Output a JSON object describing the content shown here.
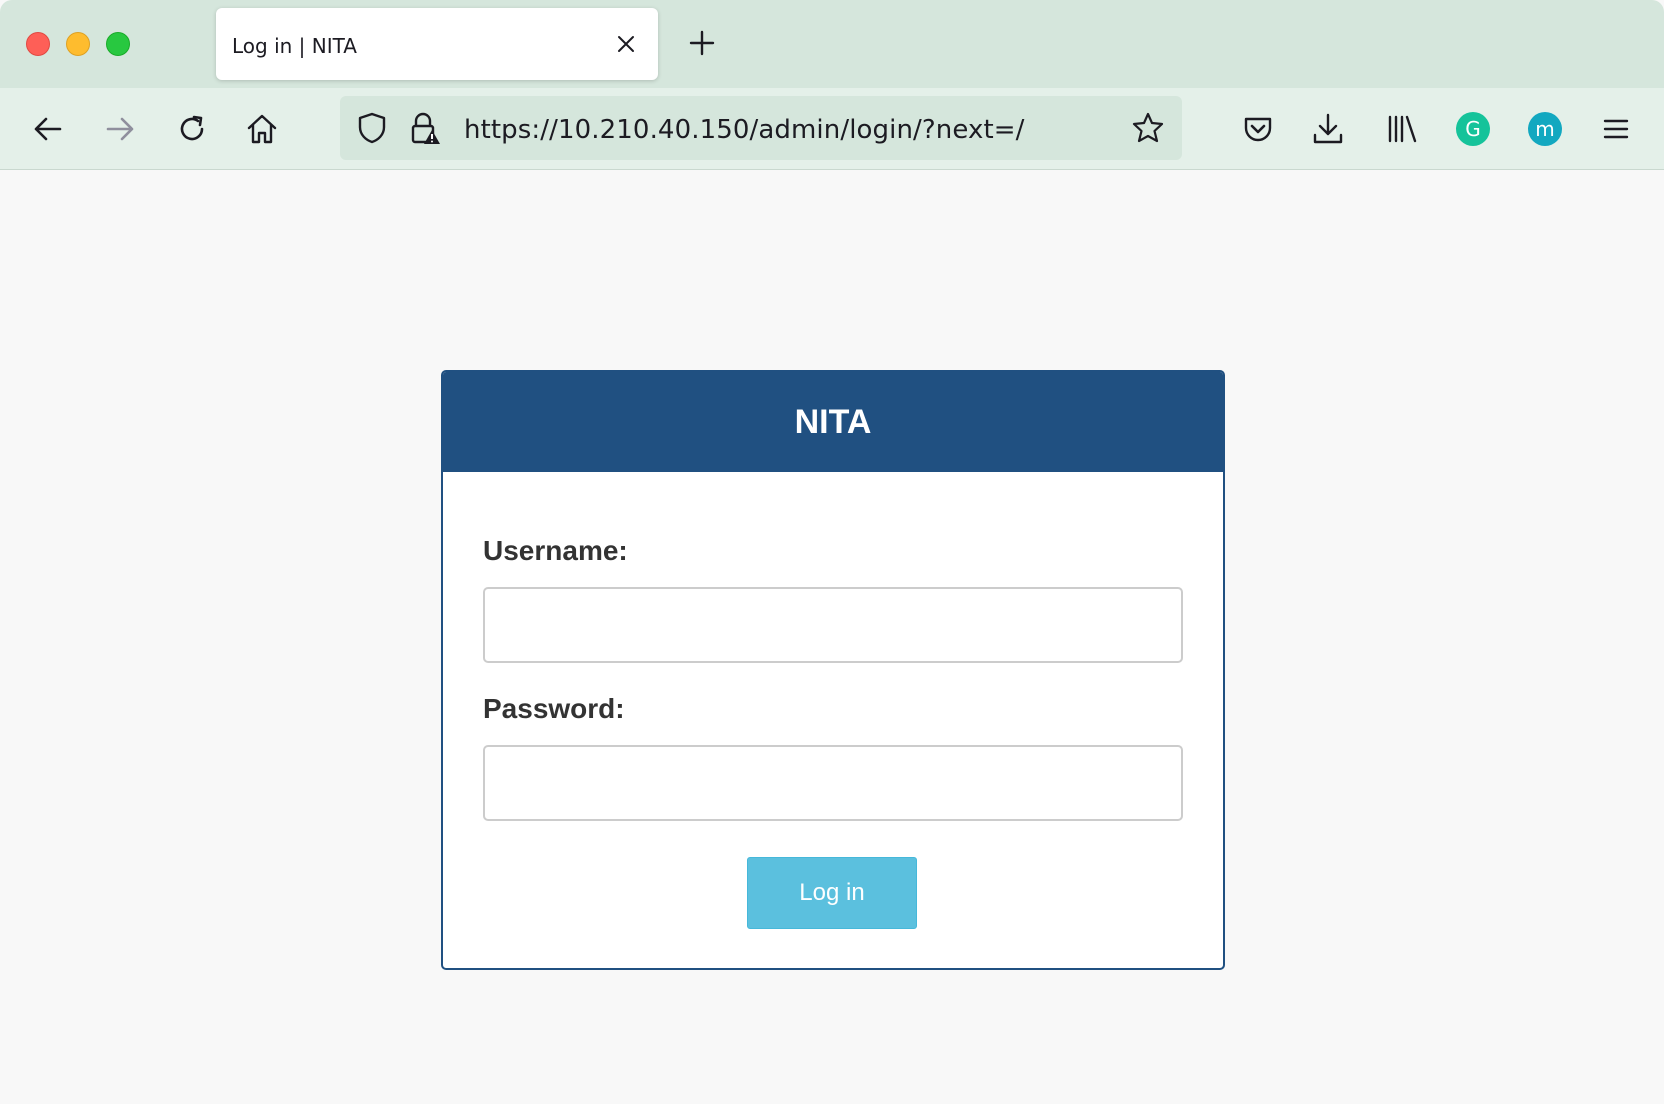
{
  "browser": {
    "tab": {
      "title": "Log in | NITA"
    },
    "url": "https://10.210.40.150/admin/login/?next=/",
    "extensions": {
      "grammarly_letter": "G",
      "m_letter": "m"
    }
  },
  "login": {
    "site_title": "NITA",
    "username_label": "Username:",
    "password_label": "Password:",
    "submit_label": "Log in",
    "username_value": "",
    "password_value": ""
  },
  "colors": {
    "header_blue": "#205081",
    "button_cyan": "#5bc0de",
    "chrome_green": "#d5e6dc"
  }
}
